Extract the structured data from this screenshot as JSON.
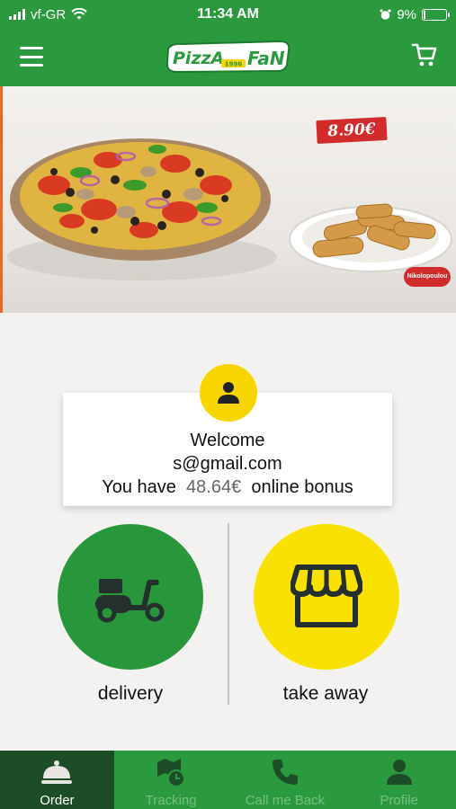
{
  "status_bar": {
    "carrier": "vf-GR",
    "time": "11:34 AM",
    "battery": "9%",
    "battery_level": 0.09
  },
  "header": {
    "logo_text": "PizzA FaN",
    "logo_year": "1996"
  },
  "banner": {
    "price": "8.90€",
    "brand": "Nikolopoulou"
  },
  "welcome": {
    "greeting": "Welcome",
    "email": "s@gmail.com",
    "bonus_prefix": "You have",
    "bonus_amount": "48.64€",
    "bonus_suffix": "online bonus"
  },
  "options": {
    "delivery_label": "delivery",
    "takeaway_label": "take away"
  },
  "nav": {
    "items": [
      {
        "label": "Order",
        "icon": "bell-icon"
      },
      {
        "label": "Tracking",
        "icon": "map-clock-icon"
      },
      {
        "label": "Call me Back",
        "icon": "phone-icon"
      },
      {
        "label": "Profile",
        "icon": "user-icon"
      }
    ],
    "active": "Order"
  },
  "colors": {
    "brand_green": "#2b9a3f",
    "dark_green": "#1d4d26",
    "brand_yellow": "#fae200",
    "price_red": "#d12b2b"
  }
}
